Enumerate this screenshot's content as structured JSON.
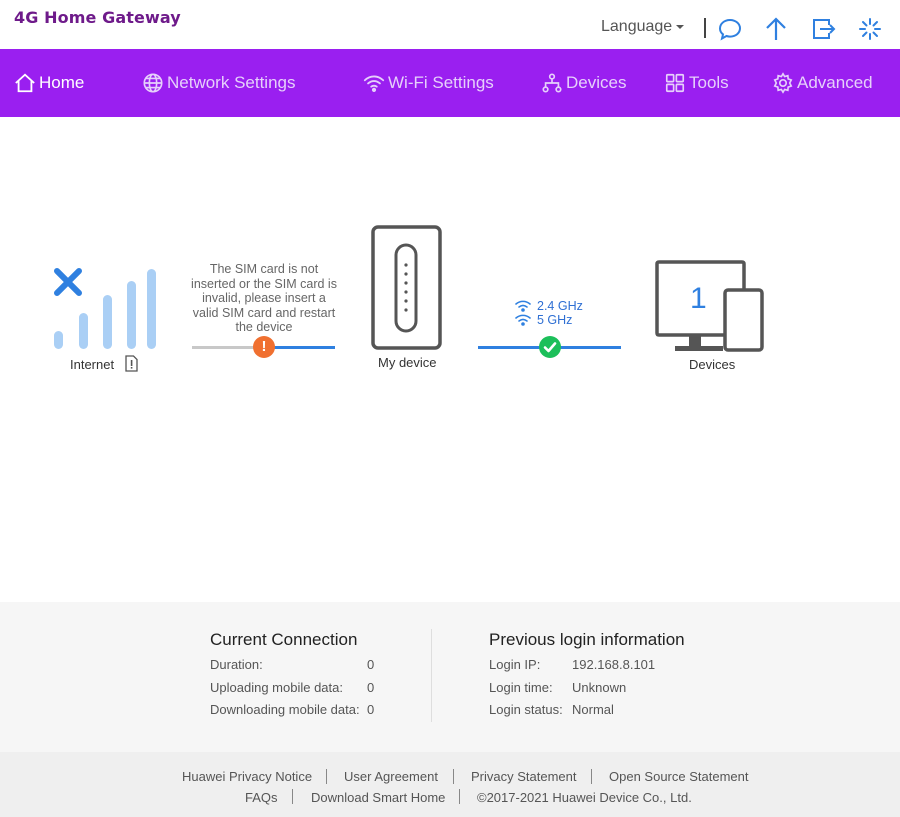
{
  "header": {
    "brand": "4G Home Gateway",
    "language_label": "Language",
    "icons": [
      "message-icon",
      "upgrade-arrow-icon",
      "logout-icon",
      "loading-spinner-icon"
    ]
  },
  "nav": {
    "items": [
      {
        "label": "Home",
        "icon": "home-icon",
        "active": true
      },
      {
        "label": "Network Settings",
        "icon": "globe-icon",
        "active": false
      },
      {
        "label": "Wi-Fi Settings",
        "icon": "wifi-icon",
        "active": false
      },
      {
        "label": "Devices",
        "icon": "devices-tree-icon",
        "active": false
      },
      {
        "label": "Tools",
        "icon": "tools-grid-icon",
        "active": false
      },
      {
        "label": "Advanced",
        "icon": "gear-icon",
        "active": false
      }
    ]
  },
  "topology": {
    "internet_label": "Internet",
    "sim_message": "The SIM card is not inserted or the SIM card is invalid, please insert a valid SIM card and restart the device",
    "my_device_label": "My device",
    "band_24": "2.4 GHz",
    "band_5": "5 GHz",
    "devices_count": "1",
    "devices_label": "Devices",
    "colors": {
      "signal_bars": "#aacff5",
      "error_x": "#2f80e0",
      "warning": "#f07030",
      "ok": "#1cbf5a",
      "link_active": "#2f80e0",
      "link_inactive": "#c8c8c8"
    }
  },
  "current_connection": {
    "title": "Current Connection",
    "rows": [
      {
        "key": "Duration:",
        "value": "0"
      },
      {
        "key": "Uploading mobile data:",
        "value": "0"
      },
      {
        "key": "Downloading mobile data:",
        "value": "0"
      }
    ]
  },
  "previous_login": {
    "title": "Previous login information",
    "rows": [
      {
        "key": "Login IP:",
        "value": "192.168.8.101"
      },
      {
        "key": "Login time:",
        "value": "Unknown"
      },
      {
        "key": "Login status:",
        "value": "Normal"
      }
    ]
  },
  "footer": {
    "links_row1": [
      "Huawei Privacy Notice",
      "User Agreement",
      "Privacy Statement",
      "Open Source Statement"
    ],
    "links_row2": [
      "FAQs",
      "Download Smart Home"
    ],
    "copyright": "©2017-2021 Huawei Device Co., Ltd."
  },
  "accent_color": "#9a1ff0",
  "brand_color": "#6e1a8a"
}
